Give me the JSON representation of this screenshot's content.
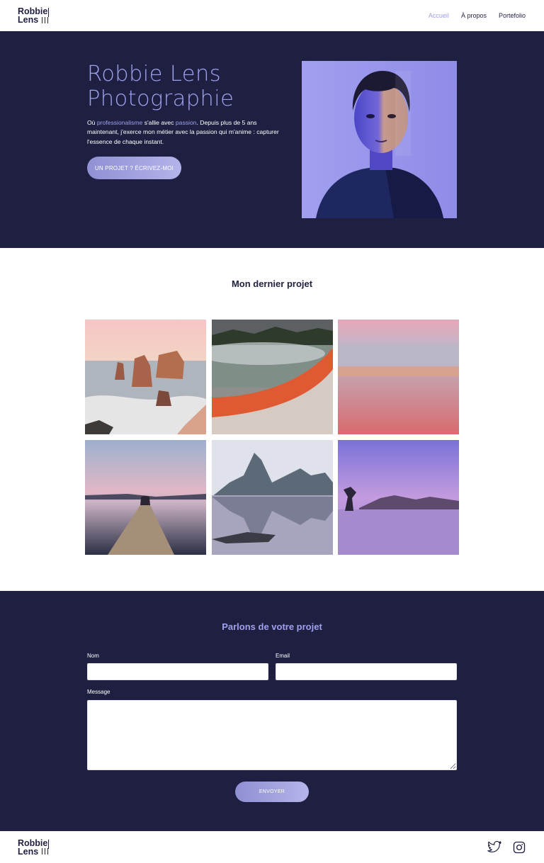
{
  "header": {
    "logo_line1": "Robbie",
    "logo_line2": "Lens",
    "nav": [
      {
        "label": "Accueil",
        "active": true
      },
      {
        "label": "À propos",
        "active": false
      },
      {
        "label": "Portefolio",
        "active": false
      }
    ]
  },
  "hero": {
    "title": "Robbie Lens Photographie",
    "text_pre": "Où ",
    "text_hl1": "professionalisme",
    "text_mid": " s'allie avec ",
    "text_hl2": "passion",
    "text_post": ". Depuis plus de 5 ans maintenant, j'exerce mon métier avec la passion qui m'anime : capturer l'essence de chaque instant.",
    "cta_label": "UN PROJET ? ÉCRIVEZ-MOI",
    "portrait_icon": "portrait-photo"
  },
  "project": {
    "title": "Mon dernier projet",
    "images": [
      "coastal-rock-stacks-photo",
      "hot-spring-photo",
      "pink-beach-sunset-photo",
      "pier-dusk-photo",
      "mountain-lake-reflection-photo",
      "purple-lake-tree-photo"
    ]
  },
  "contact": {
    "title": "Parlons de votre projet",
    "name_label": "Nom",
    "email_label": "Email",
    "message_label": "Message",
    "name_value": "",
    "email_value": "",
    "message_value": "",
    "submit_label": "ENVOYER"
  },
  "footer": {
    "logo_line1": "Robbie",
    "logo_line2": "Lens",
    "icons": [
      "twitter-icon",
      "instagram-icon"
    ]
  },
  "colors": {
    "navy": "#1f2041",
    "lavender": "#9fa1ee",
    "white": "#ffffff"
  }
}
